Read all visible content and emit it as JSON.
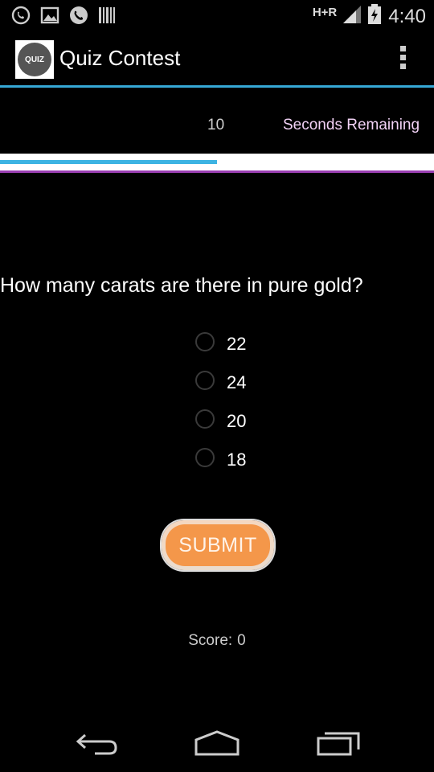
{
  "status_bar": {
    "network_type": "H+R",
    "time": "4:40"
  },
  "action_bar": {
    "app_icon_text": "QUIZ",
    "title": "Quiz Contest"
  },
  "timer": {
    "value": "10",
    "label": "Seconds Remaining",
    "progress_fraction": 0.5
  },
  "question": {
    "text": "How many carats are there in pure gold?",
    "options": [
      "22",
      "24",
      "20",
      "18"
    ]
  },
  "submit": {
    "label": "SUBMIT"
  },
  "score": {
    "label": "Score:",
    "value": "0"
  },
  "colors": {
    "accent": "#36a8d6",
    "submit_orange": "#f4974a",
    "purple_line": "#9b3fb3",
    "timer_label": "#f2d2f6"
  },
  "icons": {
    "status_left": [
      "whatsapp-icon",
      "gallery-icon",
      "phone-icon",
      "barcode-icon"
    ],
    "status_right": [
      "signal-icon",
      "battery-icon"
    ],
    "nav": [
      "back-icon",
      "home-icon",
      "recents-icon"
    ]
  }
}
